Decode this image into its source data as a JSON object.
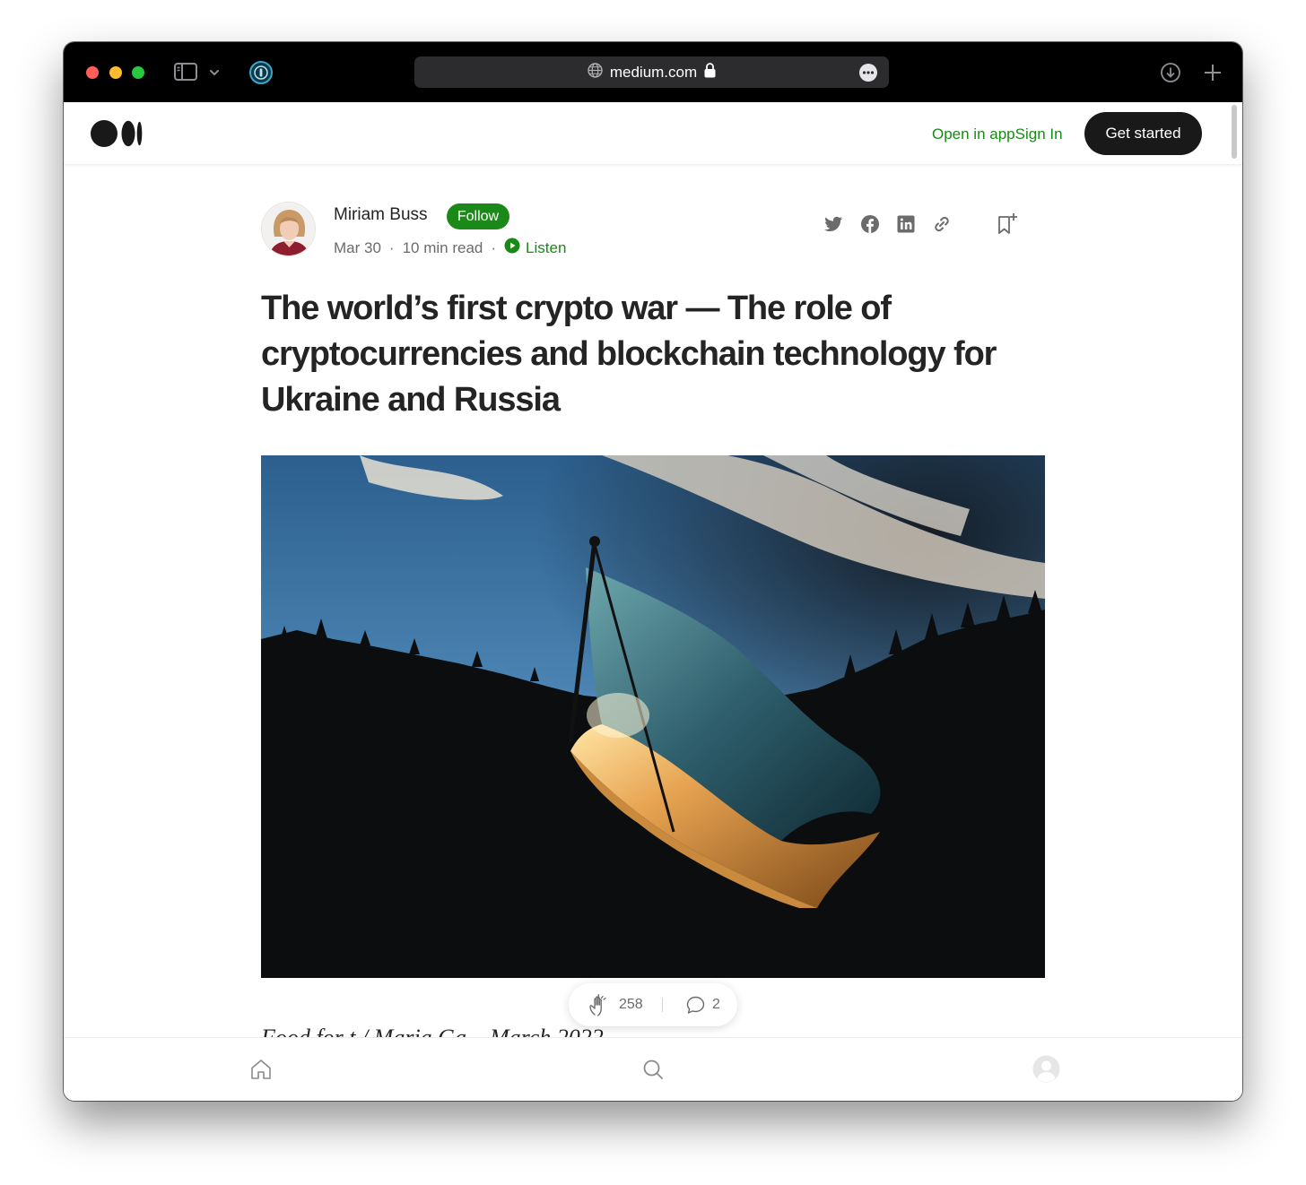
{
  "browser": {
    "url": "medium.com",
    "icons": {
      "sidebar": "sidebar-icon",
      "chevron": "chevron-down-icon",
      "password": "password-manager-icon",
      "globe": "globe-icon",
      "lock": "lock-icon",
      "more": "more-icon",
      "download": "download-icon",
      "new_tab": "plus-icon"
    }
  },
  "header": {
    "logo": "medium-logo",
    "open_in_app": "Open in app",
    "sign_in": "Sign In",
    "get_started": "Get started"
  },
  "article": {
    "author": "Miriam Buss",
    "follow": "Follow",
    "date": "Mar 30",
    "separator": "·",
    "read_time": "10 min read",
    "listen": "Listen",
    "title": "The world’s first crypto war — The role of cryptocurrencies and blockchain technology for Ukraine and Russia",
    "share_icons": [
      "twitter-icon",
      "facebook-icon",
      "linkedin-icon",
      "link-icon"
    ],
    "bookmark_icon": "bookmark-add-icon",
    "hero_image": "ukraine-flag-photo",
    "caption": "Food for t / Maria Ga... March 2022"
  },
  "engagement": {
    "claps": "258",
    "comments": "2"
  },
  "bottom_nav": {
    "items": [
      "home-icon",
      "search-icon",
      "profile-icon"
    ]
  },
  "colors": {
    "accent_green": "#1a8917",
    "button_dark": "#191919",
    "text": "#242424",
    "muted": "#6b6b6b",
    "chrome": "#000000"
  }
}
